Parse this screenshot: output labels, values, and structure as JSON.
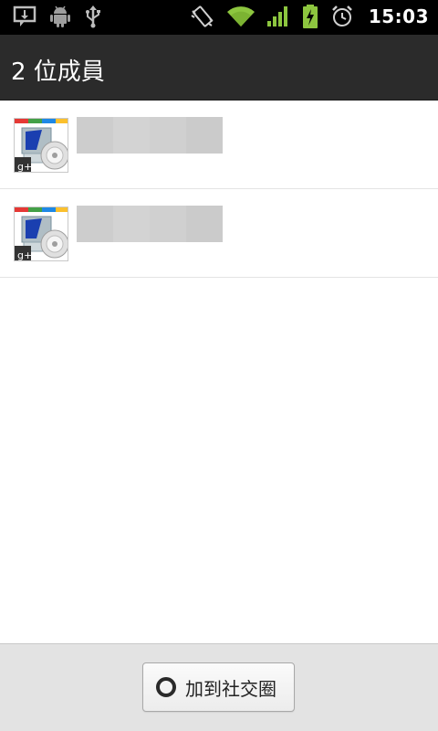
{
  "status_bar": {
    "time": "15:03",
    "left_icons": [
      "message-alert-icon",
      "android-debug-icon",
      "usb-icon"
    ],
    "right_icons": [
      "vibrate-icon",
      "wifi-icon",
      "signal-icon",
      "battery-charging-icon",
      "alarm-icon"
    ],
    "accent_color": "#8dc63f"
  },
  "header": {
    "title": "2 位成員"
  },
  "members": [
    {
      "avatar_icon": "google-plus-avatar-icon"
    },
    {
      "avatar_icon": "google-plus-avatar-icon"
    }
  ],
  "footer": {
    "add_button_label": "加到社交圈",
    "add_button_icon": "circle-icon"
  }
}
